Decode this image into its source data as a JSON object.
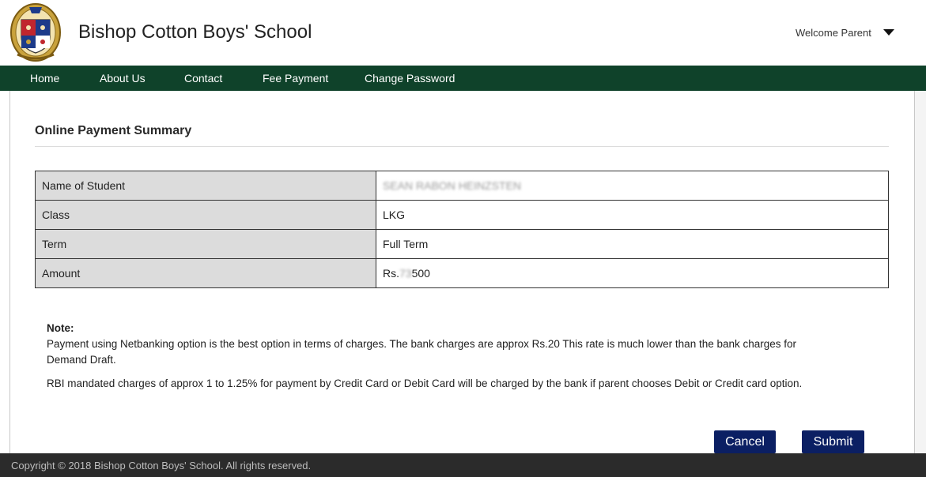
{
  "header": {
    "school_name": "Bishop Cotton Boys' School",
    "welcome": "Welcome Parent"
  },
  "nav": {
    "items": [
      "Home",
      "About Us",
      "Contact",
      "Fee Payment",
      "Change Password"
    ]
  },
  "page": {
    "title": "Online Payment Summary"
  },
  "summary": {
    "rows": [
      {
        "label": "Name of Student",
        "value": "SEAN RABON HEINZSTEN"
      },
      {
        "label": "Class",
        "value": "LKG"
      },
      {
        "label": "Term",
        "value": "Full Term"
      },
      {
        "label": "Amount",
        "prefix": "Rs.",
        "hidden": "73",
        "suffix": "500"
      }
    ]
  },
  "note": {
    "title": "Note:",
    "para1": "Payment using Netbanking option is the best option in terms of charges. The bank charges are approx Rs.20 This rate is much lower than the bank charges for Demand Draft.",
    "para2": "RBI mandated charges of approx 1 to 1.25% for payment by Credit Card or Debit Card will be charged by the bank if parent chooses Debit or Credit card option."
  },
  "buttons": {
    "cancel": "Cancel",
    "submit": "Submit"
  },
  "footer": {
    "copyright": "Copyright © 2018 Bishop Cotton Boys' School. All rights reserved."
  },
  "colors": {
    "nav_bg": "#0f422a",
    "button_bg": "#0b1f63",
    "footer_bg": "#2b2b2b",
    "label_cell_bg": "#dcdcdc"
  },
  "icons": {
    "logo": "school-crest-logo",
    "menu": "caret-down-icon"
  }
}
